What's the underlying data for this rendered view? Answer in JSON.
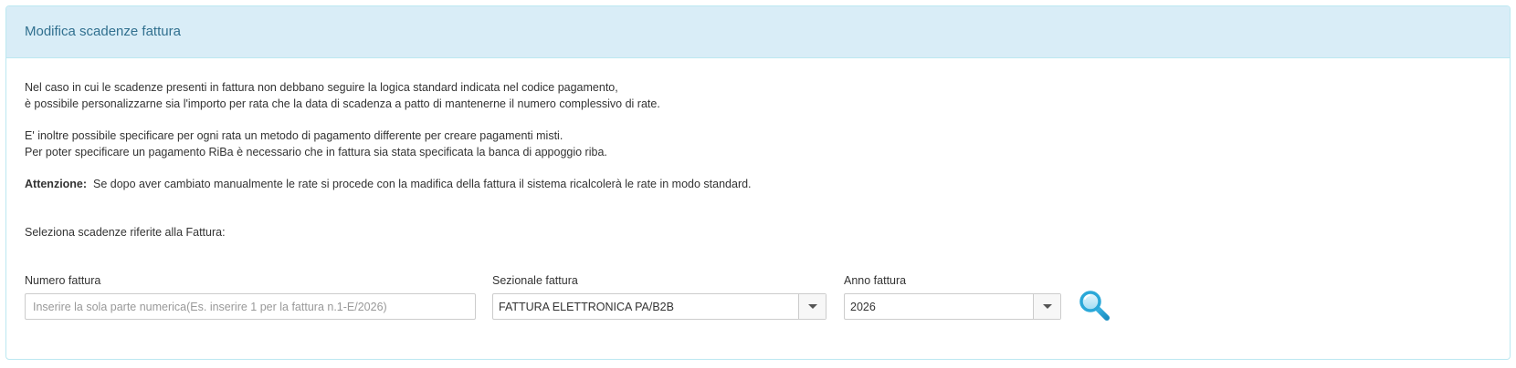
{
  "panel": {
    "title": "Modifica scadenze fattura"
  },
  "info": {
    "line1": "Nel caso in cui le scadenze presenti in fattura non debbano seguire la logica standard indicata nel codice pagamento,",
    "line2": "è possibile personalizzarne sia l'importo per rata che la data di scadenza a patto di mantenerne il numero complessivo di rate.",
    "line3": "E' inoltre possibile specificare per ogni rata un metodo di pagamento differente per creare pagamenti misti.",
    "line4": "Per poter specificare un pagamento RiBa è necessario che in fattura sia stata specificata la banca di appoggio riba.",
    "warning_label": "Attenzione:",
    "warning_text": "Se dopo aver cambiato manualmente le rate si procede con la madifica della fattura il sistema ricalcolerà le rate in modo standard."
  },
  "selection": {
    "heading": "Seleziona scadenze riferite alla Fattura:"
  },
  "form": {
    "numero_label": "Numero fattura",
    "numero_placeholder": "Inserire la sola parte numerica(Es. inserire 1 per la fattura n.1-E/2026)",
    "numero_value": "",
    "sezionale_label": "Sezionale fattura",
    "sezionale_value": "FATTURA ELETTRONICA PA/B2B",
    "anno_label": "Anno fattura",
    "anno_value": "2026"
  },
  "icons": {
    "search": "search-icon",
    "dropdown": "chevron-down-icon"
  },
  "colors": {
    "heading_bg": "#d9edf7",
    "heading_border": "#bce8f1",
    "heading_text": "#31708f",
    "search_icon": "#2aa8d8"
  }
}
